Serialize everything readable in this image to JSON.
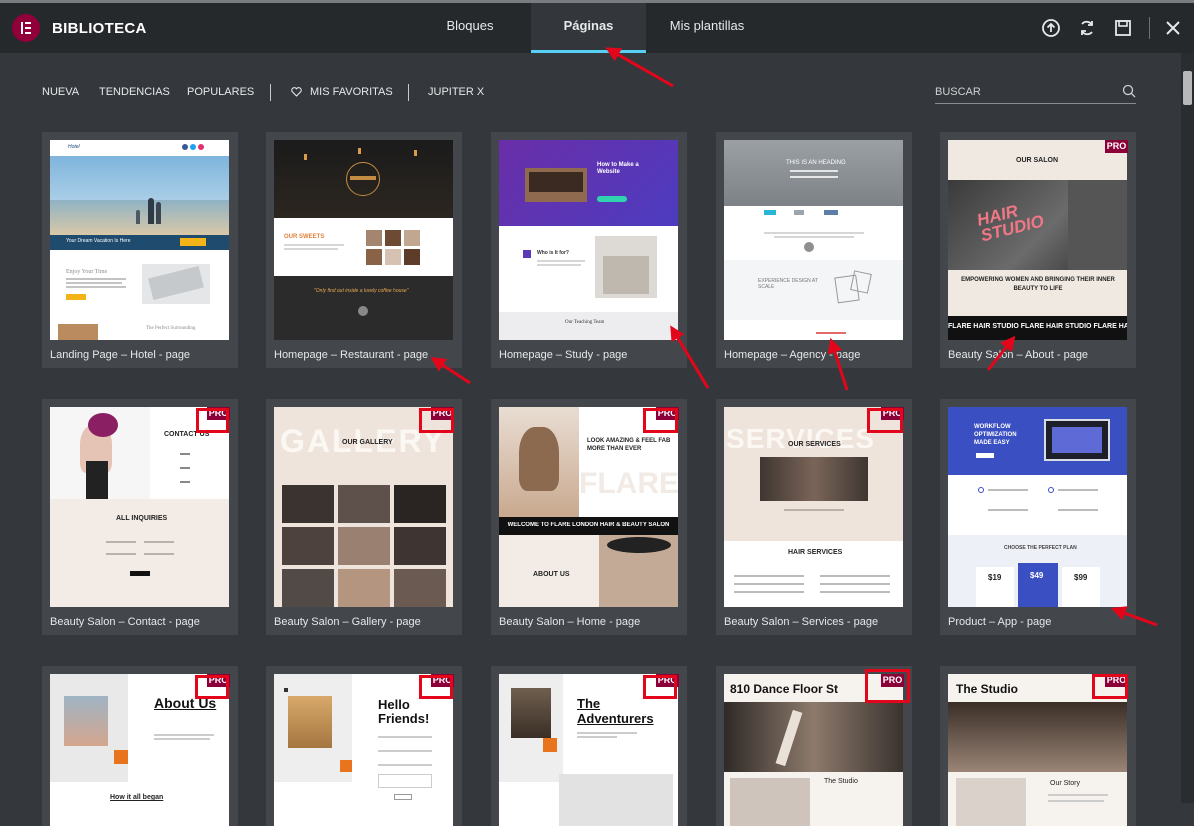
{
  "header": {
    "app_title": "BIBLIOTECA",
    "tabs": [
      {
        "label": "Bloques"
      },
      {
        "label": "Páginas"
      },
      {
        "label": "Mis plantillas"
      }
    ],
    "active_tab": "Páginas",
    "icons": [
      "upload-icon",
      "sync-icon",
      "save-icon",
      "close-icon"
    ]
  },
  "filters": {
    "items": [
      "NUEVA",
      "TENDENCIAS",
      "POPULARES",
      "MIS FAVORITAS",
      "JUPITER X"
    ],
    "search_placeholder": "BUSCAR"
  },
  "badge_text": "PRO",
  "colors": {
    "header_bg": "#26292c",
    "body_bg": "#34383c",
    "card_bg": "#43474b",
    "accent_tab": "#58d0f5",
    "pro_badge": "#8c003a",
    "annotation_red": "#e3061b"
  },
  "templates": [
    {
      "label": "Landing Page – Hotel - page",
      "pro": false,
      "thumb": {
        "banner": "Your Dream Vacation Is Here",
        "heading": "Enjoy Your Time",
        "footer_heading": "The Perfect Surrounding"
      }
    },
    {
      "label": "Homepage – Restaurant - page",
      "pro": false,
      "thumb": {
        "heading": "OUR SWEETS",
        "quote": "\"Only find out inside a lovely coffee house\""
      }
    },
    {
      "label": "Homepage – Study - page",
      "pro": false,
      "thumb": {
        "heading": "How to Make a Website",
        "mid": "Who is It for?",
        "footer_heading": "Our Teaching Team"
      }
    },
    {
      "label": "Homepage – Agency - page",
      "pro": false,
      "thumb": {
        "heading": "THIS IS AN HEADING",
        "mid": "EXPERIENCE DESIGN AT SCALE"
      }
    },
    {
      "label": "Beauty Salon – About - page",
      "pro": true,
      "thumb": {
        "heading": "OUR SALON",
        "sign": "HAIR STUDIO",
        "tagline": "EMPOWERING WOMEN AND BRINGING THEIR INNER BEAUTY TO LIFE",
        "ticker": "FLARE HAIR STUDIO FLARE HAIR STUDIO FLARE HAIR"
      }
    },
    {
      "label": "Beauty Salon – Contact - page",
      "pro": true,
      "thumb": {
        "heading": "CONTACT US",
        "mid": "ALL INQUIRIES"
      }
    },
    {
      "label": "Beauty Salon – Gallery - page",
      "pro": true,
      "thumb": {
        "bg_word": "GALLERY",
        "heading": "OUR GALLERY"
      }
    },
    {
      "label": "Beauty Salon – Home - page",
      "pro": true,
      "thumb": {
        "heading": "LOOK AMAZING & FEEL FAB MORE THAN EVER",
        "bg_word": "FLARE",
        "banner": "WELCOME TO FLARE LONDON HAIR & BEAUTY SALON",
        "mid": "ABOUT US"
      }
    },
    {
      "label": "Beauty Salon – Services - page",
      "pro": true,
      "thumb": {
        "bg_word": "SERVICES",
        "heading": "OUR SERVICES",
        "mid": "HAIR SERVICES"
      }
    },
    {
      "label": "Product – App - page",
      "pro": false,
      "thumb": {
        "heading": "WORKFLOW OPTIMIZATION MADE EASY",
        "mid": "CHOOSE THE PERFECT PLAN",
        "prices": [
          "$19",
          "$49",
          "$99"
        ]
      }
    },
    {
      "label": "",
      "pro": true,
      "thumb": {
        "heading": "About Us",
        "footer_heading": "How it all began"
      }
    },
    {
      "label": "",
      "pro": true,
      "thumb": {
        "heading": "Hello Friends!"
      }
    },
    {
      "label": "",
      "pro": true,
      "thumb": {
        "heading": "The Adventurers"
      }
    },
    {
      "label": "",
      "pro": true,
      "thumb": {
        "heading": "810 Dance Floor St",
        "mid": "The Studio"
      }
    },
    {
      "label": "",
      "pro": true,
      "thumb": {
        "heading": "The Studio",
        "mid": "Our Story"
      }
    }
  ]
}
